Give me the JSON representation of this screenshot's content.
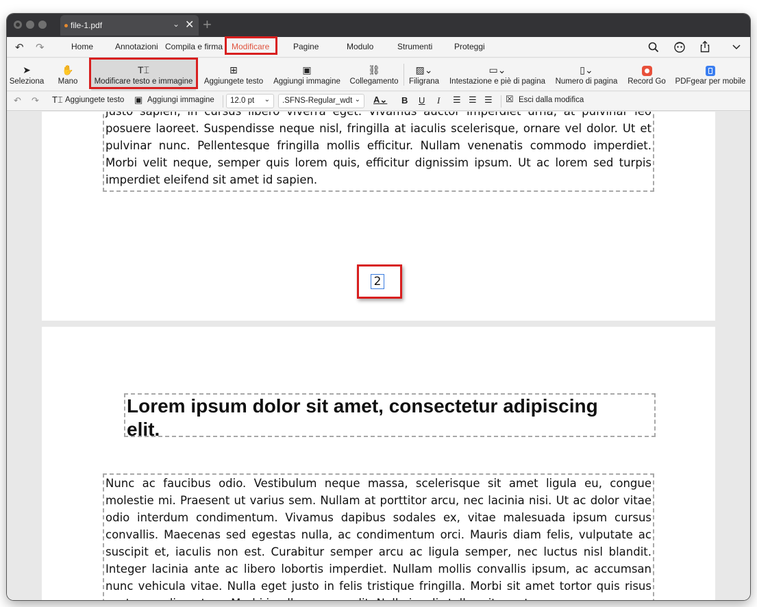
{
  "tab": {
    "filename": "file-1.pdf"
  },
  "menu": [
    "Home",
    "Annotazioni",
    "Compila e firma",
    "Modificare",
    "Pagine",
    "Modulo",
    "Strumenti",
    "Proteggi"
  ],
  "menu_active": "Modificare",
  "toolbar": {
    "seleziona": "Seleziona",
    "mano": "Mano",
    "modificare": "Modificare testo e immagine",
    "aggiungete_testo": "Aggiungete testo",
    "aggiungi_immagine": "Aggiungi immagine",
    "collegamento": "Collegamento",
    "filigrana": "Filigrana",
    "intestazione": "Intestazione e piè di pagina",
    "numero": "Numero di pagina",
    "record": "Record Go",
    "pdfgear": "PDFgear per mobile"
  },
  "formatbar": {
    "aggiungete_testo": "Aggiungete testo",
    "aggiungi_immagine": "Aggiungi immagine",
    "font_size": "12.0 pt",
    "font_name": ".SFNS-Regular_wdt",
    "bold": "B",
    "underline": "U",
    "italic": "I",
    "exit": "Esci dalla modifica"
  },
  "document": {
    "page1_text": "justo sapien, in cursus libero viverra eget. Vivamus auctor imperdiet urna, at pulvinar leo posuere laoreet. Suspendisse neque nisl, fringilla at iaculis scelerisque, ornare vel dolor. Ut et pulvinar nunc. Pellentesque fringilla mollis efficitur. Nullam venenatis commodo imperdiet. Morbi velit neque, semper quis lorem quis, efficitur dignissim ipsum. Ut ac lorem sed turpis imperdiet eleifend sit amet id sapien.",
    "page_number": "2",
    "heading": "Lorem ipsum dolor sit amet, consectetur adipiscing elit.",
    "page2_text": "Nunc ac faucibus odio. Vestibulum neque massa, scelerisque sit amet ligula eu, congue molestie mi. Praesent ut varius sem. Nullam at porttitor arcu, nec lacinia nisi. Ut ac dolor vitae odio interdum condimentum. Vivamus dapibus sodales ex, vitae malesuada ipsum cursus convallis. Maecenas sed egestas nulla, ac condimentum orci. Mauris diam felis, vulputate ac suscipit et, iaculis non est. Curabitur semper arcu ac ligula semper, nec luctus nisl blandit. Integer lacinia ante ac libero lobortis imperdiet. Nullam mollis convallis ipsum, ac accumsan nunc vehicula vitae. Nulla eget justo in felis tristique fringilla. Morbi sit amet tortor quis risus auctor condimentum. Morbi in ullamcorper elit. Nulla iaculis tellus sit amet"
  },
  "colors": {
    "accent": "#e0523d",
    "highlight_box": "#d81f1f",
    "selection_blue": "#3b7de0",
    "record_icon": "#e8503a",
    "mobile_icon": "#3a7ef0"
  }
}
